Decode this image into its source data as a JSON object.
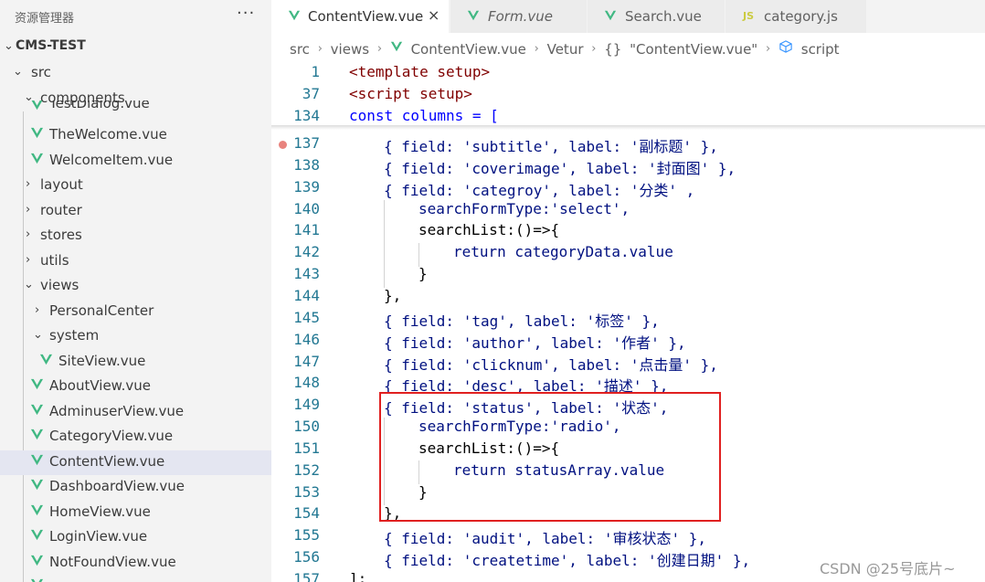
{
  "explorer": {
    "title": "资源管理器",
    "more": "···",
    "items": [
      {
        "label": "CMS-TEST",
        "kind": "folder-open",
        "bold": true
      },
      {
        "label": "src",
        "kind": "folder-open"
      },
      {
        "label": "components",
        "kind": "folder-open"
      },
      {
        "label": "TestDialog.vue",
        "kind": "vue"
      },
      {
        "label": "TheWelcome.vue",
        "kind": "vue"
      },
      {
        "label": "WelcomeItem.vue",
        "kind": "vue"
      },
      {
        "label": "layout",
        "kind": "folder-closed"
      },
      {
        "label": "router",
        "kind": "folder-closed"
      },
      {
        "label": "stores",
        "kind": "folder-closed"
      },
      {
        "label": "utils",
        "kind": "folder-closed"
      },
      {
        "label": "views",
        "kind": "folder-open"
      },
      {
        "label": "PersonalCenter",
        "kind": "folder-closed"
      },
      {
        "label": "system",
        "kind": "folder-open"
      },
      {
        "label": "SiteView.vue",
        "kind": "vue"
      },
      {
        "label": "AboutView.vue",
        "kind": "vue"
      },
      {
        "label": "AdminuserView.vue",
        "kind": "vue"
      },
      {
        "label": "CategoryView.vue",
        "kind": "vue"
      },
      {
        "label": "ContentView.vue",
        "kind": "vue",
        "selected": true
      },
      {
        "label": "DashboardView.vue",
        "kind": "vue"
      },
      {
        "label": "HomeView.vue",
        "kind": "vue"
      },
      {
        "label": "LoginView.vue",
        "kind": "vue"
      },
      {
        "label": "NotFoundView.vue",
        "kind": "vue"
      }
    ]
  },
  "tabs": [
    {
      "label": "ContentView.vue",
      "icon": "vue-icon",
      "active": true,
      "close": "×"
    },
    {
      "label": "Form.vue",
      "icon": "vue-icon",
      "italic": true
    },
    {
      "label": "Search.vue",
      "icon": "vue-icon"
    },
    {
      "label": "category.js",
      "icon": "js-icon",
      "icon_text": "JS"
    }
  ],
  "breadcrumb": {
    "src": "src",
    "views": "views",
    "file": "ContentView.vue",
    "vetur": "Vetur",
    "obj_icon": "{}",
    "obj": "\"ContentView.vue\"",
    "script": "script"
  },
  "code": {
    "sticky": [
      {
        "ln": "1",
        "text": "<template setup>"
      },
      {
        "ln": "37",
        "text": "<script setup>"
      },
      {
        "ln": "134",
        "text": "const columns = ["
      }
    ],
    "lines": [
      {
        "ln": "137",
        "text": "{ field: 'subtitle', label: '副标题' },",
        "breakpoint": true
      },
      {
        "ln": "138",
        "text": "{ field: 'coverimage', label: '封面图' },"
      },
      {
        "ln": "139",
        "text": "{ field: 'categroy', label: '分类' ,"
      },
      {
        "ln": "140",
        "text": "searchFormType:'select',"
      },
      {
        "ln": "141",
        "text": "searchList:()=>{"
      },
      {
        "ln": "142",
        "text": "return categoryData.value"
      },
      {
        "ln": "143",
        "text": "}"
      },
      {
        "ln": "144",
        "text": "},"
      },
      {
        "ln": "145",
        "text": "{ field: 'tag', label: '标签' },"
      },
      {
        "ln": "146",
        "text": "{ field: 'author', label: '作者' },"
      },
      {
        "ln": "147",
        "text": "{ field: 'clicknum', label: '点击量' },"
      },
      {
        "ln": "148",
        "text": "{ field: 'desc', label: '描述' },"
      },
      {
        "ln": "149",
        "text": "{ field: 'status', label: '状态',"
      },
      {
        "ln": "150",
        "text": "searchFormType:'radio',"
      },
      {
        "ln": "151",
        "text": "searchList:()=>{"
      },
      {
        "ln": "152",
        "text": "return statusArray.value"
      },
      {
        "ln": "153",
        "text": "}"
      },
      {
        "ln": "154",
        "text": "},"
      },
      {
        "ln": "155",
        "text": "{ field: 'audit', label: '审核状态' },"
      },
      {
        "ln": "156",
        "text": "{ field: 'createtime', label: '创建日期' },"
      },
      {
        "ln": "157",
        "text": "];"
      }
    ]
  },
  "watermark": "CSDN @25号底片~",
  "colors": {
    "accent_vue": "#41b883",
    "highlight_border": "#e02020",
    "line_number": "#237893"
  }
}
